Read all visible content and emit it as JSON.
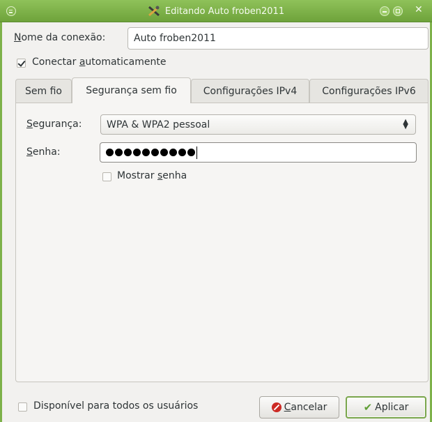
{
  "window": {
    "title": "Editando Auto froben2011"
  },
  "connection": {
    "name_label": "Nome da conexão:",
    "name_value": "Auto froben2011",
    "auto_connect_label": "Conectar automaticamente",
    "auto_connect_checked": true
  },
  "tabs": [
    {
      "label": "Sem fio",
      "active": false
    },
    {
      "label": "Segurança sem fio",
      "active": true
    },
    {
      "label": "Configurações IPv4",
      "active": false
    },
    {
      "label": "Configurações IPv6",
      "active": false
    }
  ],
  "security": {
    "security_label": "Segurança:",
    "security_value": "WPA & WPA2 pessoal",
    "password_label": "Senha:",
    "password_mask_count": 10,
    "show_password_label": "Mostrar senha",
    "show_password_checked": false
  },
  "footer": {
    "all_users_label": "Disponível para todos os usuários",
    "all_users_checked": false,
    "cancel_label": "Cancelar",
    "apply_label": "Aplicar"
  },
  "icons": {
    "window_menu": "window-menu-icon",
    "app": "network-tools-icon",
    "minimize": "minimize-icon",
    "maximize": "maximize-icon",
    "close": "close-icon",
    "combo": "updown-chevron-icon",
    "cancel": "cancel-icon",
    "apply": "checkmark-icon"
  },
  "colors": {
    "titlebar": "#7db14a",
    "default_button_border": "#7aa64d",
    "cancel_icon": "#cc2a24",
    "apply_icon": "#5e9e34"
  }
}
